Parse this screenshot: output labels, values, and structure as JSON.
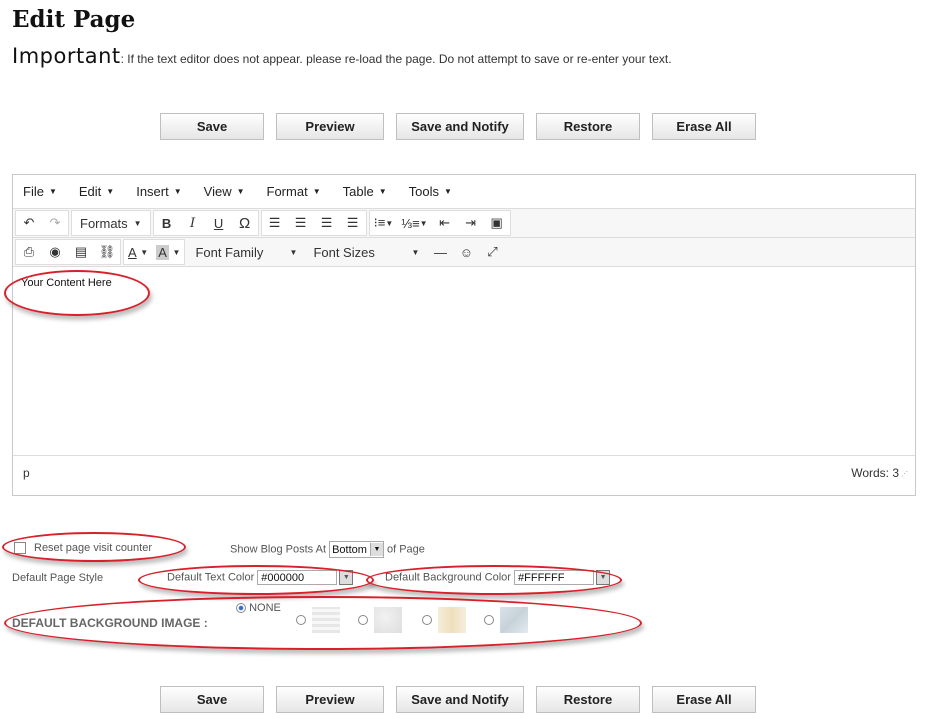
{
  "page": {
    "title": "Edit Page",
    "important_label": "Important",
    "important_text": ": If the text editor does not appear. please re-load the page.  Do not attempt  to save or re-enter your text."
  },
  "buttons": {
    "save": "Save",
    "preview": "Preview",
    "save_notify": "Save and Notify",
    "restore": "Restore",
    "erase_all": "Erase All"
  },
  "editor": {
    "menu": [
      "File",
      "Edit",
      "Insert",
      "View",
      "Format",
      "Table",
      "Tools"
    ],
    "toolbar": {
      "formats": "Formats",
      "font_family": "Font Family",
      "font_sizes": "Font Sizes"
    },
    "content": "Your Content Here",
    "status_path": "p",
    "word_count": "Words: 3"
  },
  "options": {
    "reset_counter": "Reset page visit counter",
    "show_blog_label": "Show Blog Posts At",
    "show_blog_value": "Bottom",
    "show_blog_suffix": "of Page",
    "default_style": "Default Page Style",
    "text_color_label": "Default  Text Color",
    "text_color_value": "#000000",
    "bg_color_label": "Default Background Color",
    "bg_color_value": "#FFFFFF",
    "bg_image_label": "DEFAULT BACKGROUND IMAGE :",
    "none_label": "NONE"
  },
  "colors": {
    "annotation_red": "#d8202a"
  }
}
